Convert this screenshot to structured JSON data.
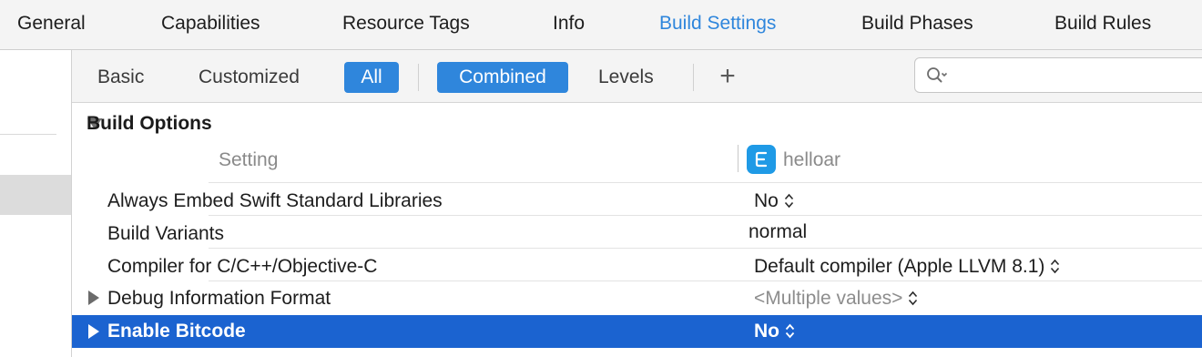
{
  "tabs": [
    {
      "label": "General"
    },
    {
      "label": "Capabilities"
    },
    {
      "label": "Resource Tags"
    },
    {
      "label": "Info"
    },
    {
      "label": "Build Settings"
    },
    {
      "label": "Build Phases"
    },
    {
      "label": "Build Rules"
    }
  ],
  "active_tab": "Build Settings",
  "filter": {
    "basic": "Basic",
    "customized": "Customized",
    "all": "All",
    "combined": "Combined",
    "levels": "Levels",
    "add": "+"
  },
  "search": {
    "placeholder": ""
  },
  "section": {
    "title": "Build Options",
    "column_setting": "Setting",
    "target_name": "helloar"
  },
  "settings": [
    {
      "name": "Always Embed Swift Standard Libraries",
      "value": "No"
    },
    {
      "name": "Build Variants",
      "value": "normal"
    },
    {
      "name": "Compiler for C/C++/Objective-C",
      "value": "Default compiler (Apple LLVM 8.1)"
    },
    {
      "name": "Debug Information Format",
      "value": "<Multiple values>"
    },
    {
      "name": "Enable Bitcode",
      "value": "No"
    }
  ],
  "colors": {
    "accent": "#2f86dc",
    "selection": "#1b63d0",
    "target_icon": "#1f9ae6"
  },
  "icons": {
    "search": "magnifier-with-dropdown-icon",
    "target": "extension-target-icon",
    "stepper": "up-down-stepper-icon",
    "disclosure": "disclosure-triangle-icon"
  }
}
